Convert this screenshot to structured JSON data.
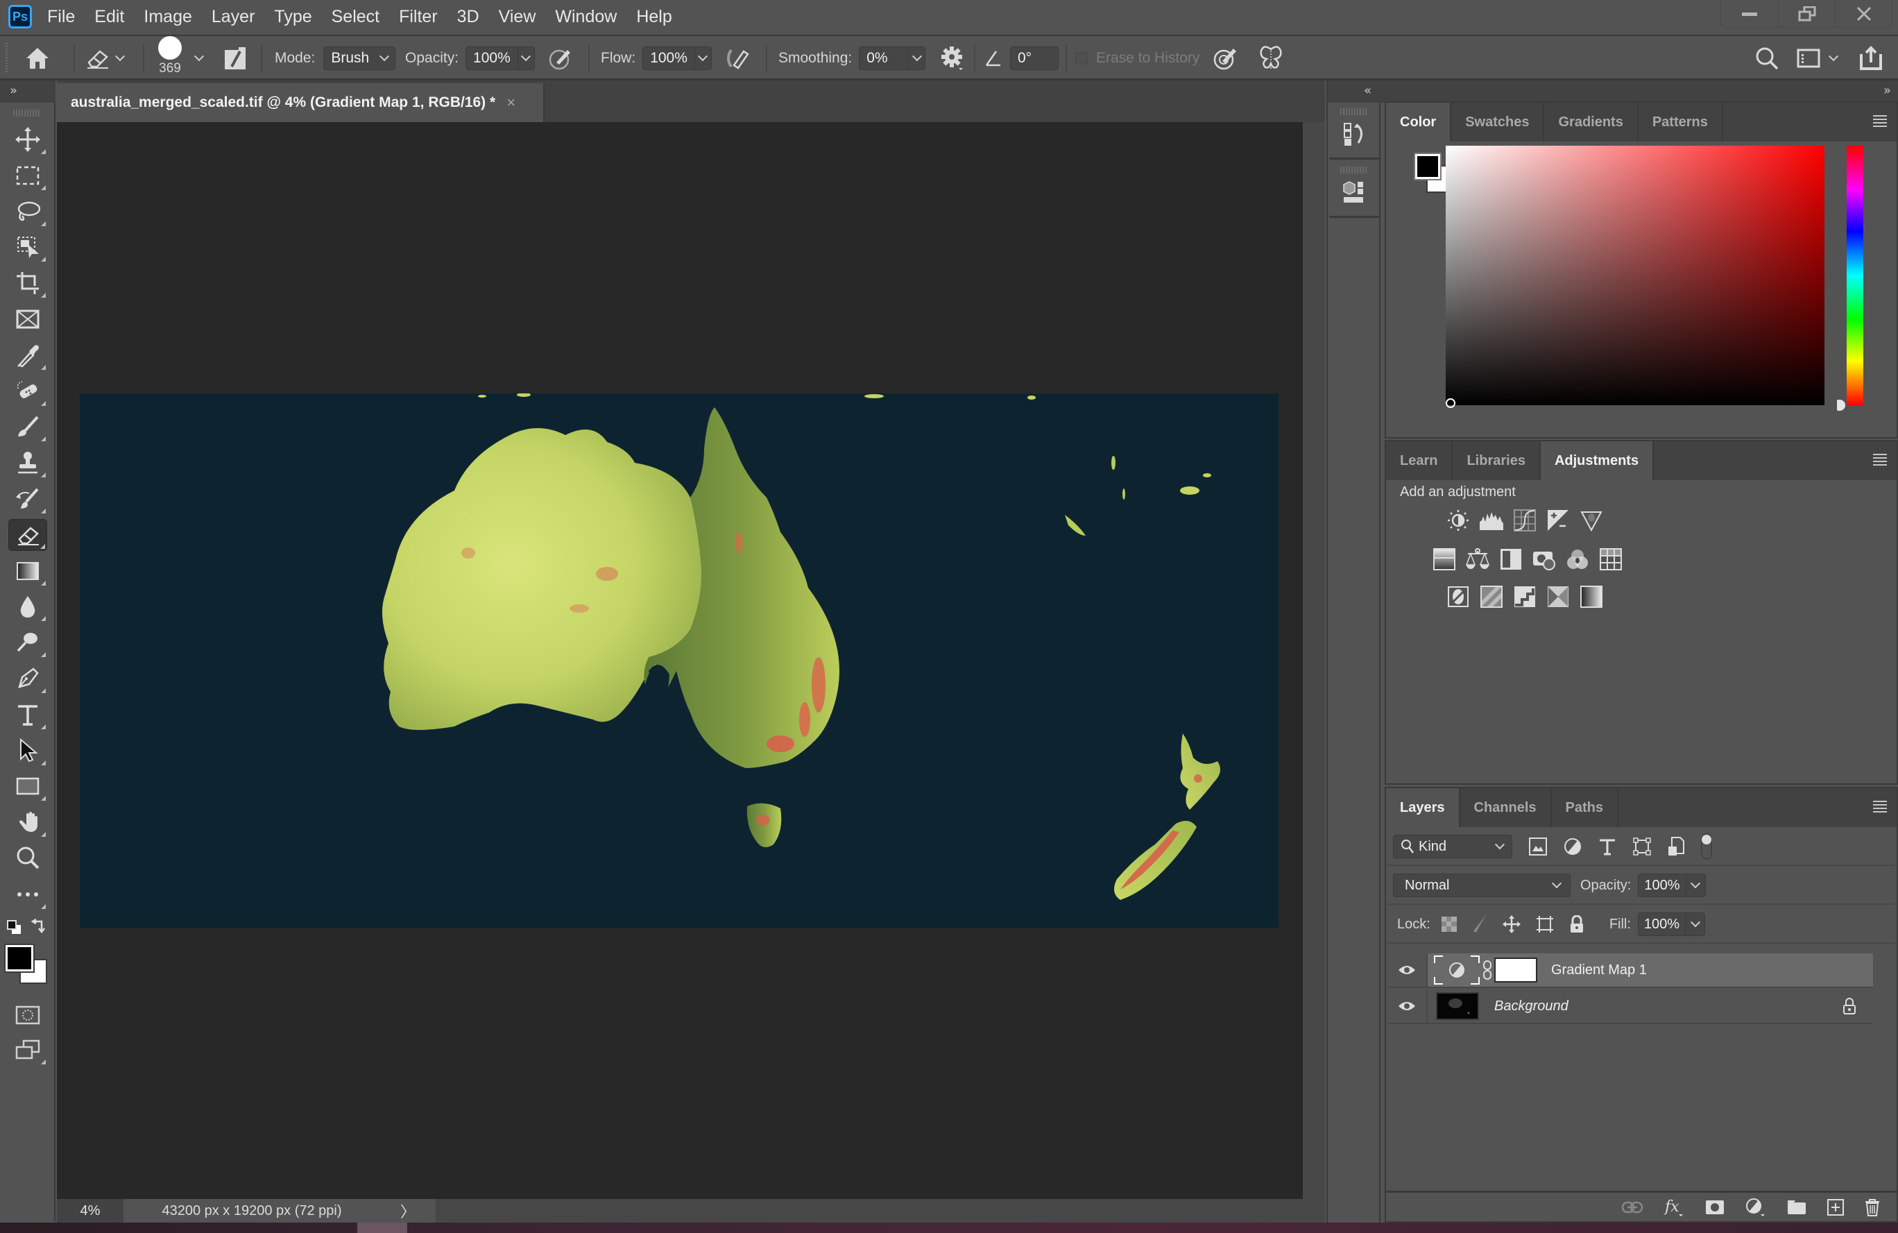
{
  "app": {
    "logo": "Ps",
    "menu": [
      "File",
      "Edit",
      "Image",
      "Layer",
      "Type",
      "Select",
      "Filter",
      "3D",
      "View",
      "Window",
      "Help"
    ],
    "window_controls": [
      "minimize-icon",
      "restore-icon",
      "close-icon"
    ]
  },
  "options_bar": {
    "tool_icon": "eraser-icon",
    "brush_size": "369",
    "mode_label": "Mode:",
    "mode_value": "Brush",
    "opacity_label": "Opacity:",
    "opacity_value": "100%",
    "flow_label": "Flow:",
    "flow_value": "100%",
    "smoothing_label": "Smoothing:",
    "smoothing_value": "0%",
    "angle_value": "0°",
    "erase_to_history_label": "Erase to History",
    "erase_to_history_checked": false,
    "right_icons": [
      "search-icon",
      "workspace-icon",
      "share-icon"
    ]
  },
  "document": {
    "tab_title": "australia_merged_scaled.tif @ 4% (Gradient Map 1, RGB/16) *",
    "close_glyph": "×",
    "zoom": "4%",
    "dimensions": "43200 px x 19200 px (72 ppi)",
    "status_arrow": "〉",
    "background_color": "#0d2430"
  },
  "tools": [
    {
      "name": "move-tool",
      "icon": "move-icon"
    },
    {
      "name": "marquee-tool",
      "icon": "rect-marquee-icon"
    },
    {
      "name": "lasso-tool",
      "icon": "lasso-icon"
    },
    {
      "name": "object-selection-tool",
      "icon": "object-select-icon"
    },
    {
      "name": "crop-tool",
      "icon": "crop-icon"
    },
    {
      "name": "frame-tool",
      "icon": "frame-icon"
    },
    {
      "name": "eyedropper-tool",
      "icon": "eyedropper-icon"
    },
    {
      "name": "healing-brush-tool",
      "icon": "bandage-icon"
    },
    {
      "name": "brush-tool",
      "icon": "brush-icon"
    },
    {
      "name": "clone-stamp-tool",
      "icon": "stamp-icon"
    },
    {
      "name": "history-brush-tool",
      "icon": "history-brush-icon"
    },
    {
      "name": "eraser-tool",
      "icon": "eraser-icon",
      "active": true
    },
    {
      "name": "gradient-tool",
      "icon": "gradient-icon"
    },
    {
      "name": "blur-tool",
      "icon": "drop-icon"
    },
    {
      "name": "dodge-tool",
      "icon": "dodge-icon"
    },
    {
      "name": "pen-tool",
      "icon": "pen-icon"
    },
    {
      "name": "type-tool",
      "icon": "type-icon"
    },
    {
      "name": "path-selection-tool",
      "icon": "arrow-icon"
    },
    {
      "name": "rectangle-tool",
      "icon": "rectangle-icon"
    },
    {
      "name": "hand-tool",
      "icon": "hand-icon"
    },
    {
      "name": "zoom-tool",
      "icon": "zoom-icon"
    },
    {
      "name": "edit-toolbar",
      "icon": "more-icon"
    }
  ],
  "colors": {
    "foreground": "#000000",
    "background": "#ffffff",
    "hue_accent": "#ff0000"
  },
  "color_panel": {
    "tabs": [
      "Color",
      "Swatches",
      "Gradients",
      "Patterns"
    ],
    "active_tab": "Color"
  },
  "adjustments_panel": {
    "tabs": [
      "Learn",
      "Libraries",
      "Adjustments"
    ],
    "active_tab": "Adjustments",
    "heading": "Add an adjustment",
    "rows": [
      [
        "brightness-contrast-icon",
        "levels-icon",
        "curves-icon",
        "exposure-icon",
        "vibrance-icon"
      ],
      [
        "hue-saturation-icon",
        "color-balance-icon",
        "black-white-icon",
        "photo-filter-icon",
        "channel-mixer-icon",
        "color-lookup-icon"
      ],
      [
        "invert-icon",
        "posterize-icon",
        "threshold-icon",
        "selective-color-icon",
        "gradient-map-icon"
      ]
    ]
  },
  "layers_panel": {
    "tabs": [
      "Layers",
      "Channels",
      "Paths"
    ],
    "active_tab": "Layers",
    "filter_label": "Kind",
    "blend_mode": "Normal",
    "opacity_label": "Opacity:",
    "opacity_value": "100%",
    "lock_label": "Lock:",
    "fill_label": "Fill:",
    "fill_value": "100%",
    "layers": [
      {
        "name": "Gradient Map 1",
        "visible": true,
        "selected": true,
        "type": "adjustment"
      },
      {
        "name": "Background",
        "visible": true,
        "selected": false,
        "locked": true,
        "type": "pixel"
      }
    ],
    "footer_icons": [
      "link-icon",
      "fx-icon",
      "mask-icon",
      "adjustment-layer-icon",
      "group-icon",
      "new-layer-icon",
      "trash-icon"
    ]
  }
}
